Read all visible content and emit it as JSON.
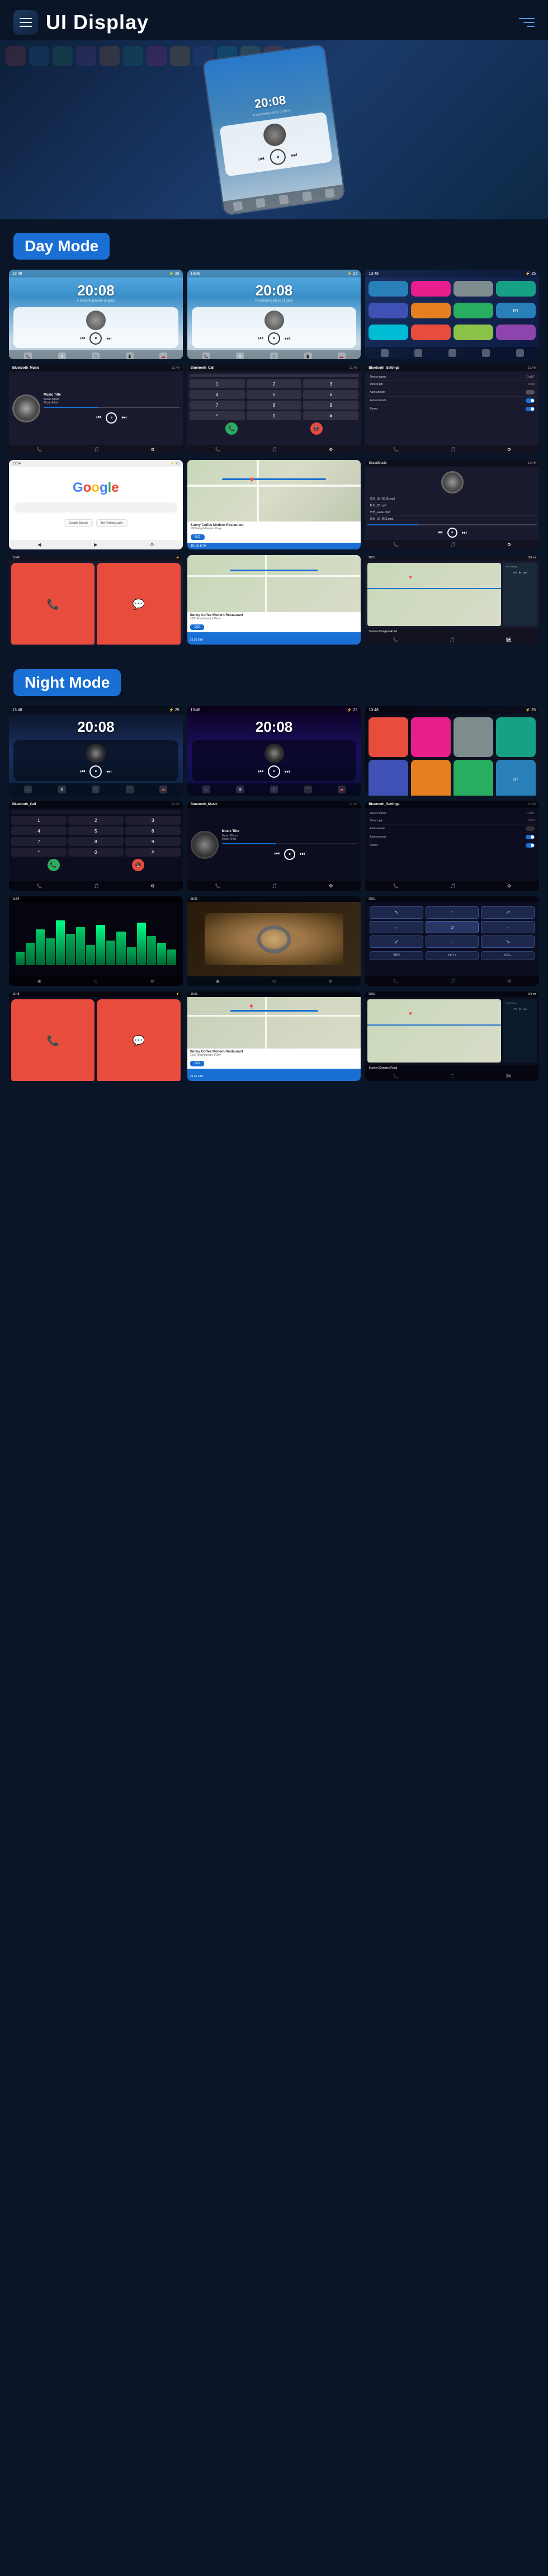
{
  "header": {
    "title": "UI Display",
    "menu_icon_label": "menu",
    "hamburger_icon_label": "hamburger"
  },
  "sections": {
    "day_mode": "Day Mode",
    "night_mode": "Night Mode"
  },
  "day_screens": {
    "home1": {
      "time": "20:08",
      "subtitle": "A scorching blaze of glory"
    },
    "home2": {
      "time": "20:08",
      "subtitle": "A scorching blaze of glory"
    }
  },
  "night_screens": {
    "home1": {
      "time": "20:08",
      "subtitle": ""
    },
    "home2": {
      "time": "20:08",
      "subtitle": ""
    }
  },
  "music": {
    "title": "Music Title",
    "album": "Music Album",
    "artist": "Music Artist"
  },
  "bluetooth": {
    "call_label": "Bluetooth_Call",
    "music_label": "Bluetooth_Music",
    "settings_label": "Bluetooth_Settings"
  },
  "settings": {
    "device_name_label": "Device name",
    "device_name_value": "CarBT",
    "device_pin_label": "Device pin",
    "device_pin_value": "0000",
    "auto_answer_label": "Auto answer",
    "auto_connect_label": "Auto connect",
    "power_label": "Power"
  },
  "poi": {
    "name": "Sunny Coffee Modern Restaurant",
    "address": "1600 Amphitheatre Pkwy",
    "eta_label": "16:16 ETA",
    "eta_value": "16:16",
    "go_label": "GO"
  },
  "navigation": {
    "distance": "10/16 ETA  9.0 mi",
    "instruction": "Start on Donglue Road",
    "not_playing": "Not Playing"
  },
  "social_music": {
    "songs": [
      "华乐_03_REJE.mp3",
      "新乐_05.mp3",
      "华乐_EEJE.mp3",
      "华乐_02_测试.mp3"
    ]
  }
}
